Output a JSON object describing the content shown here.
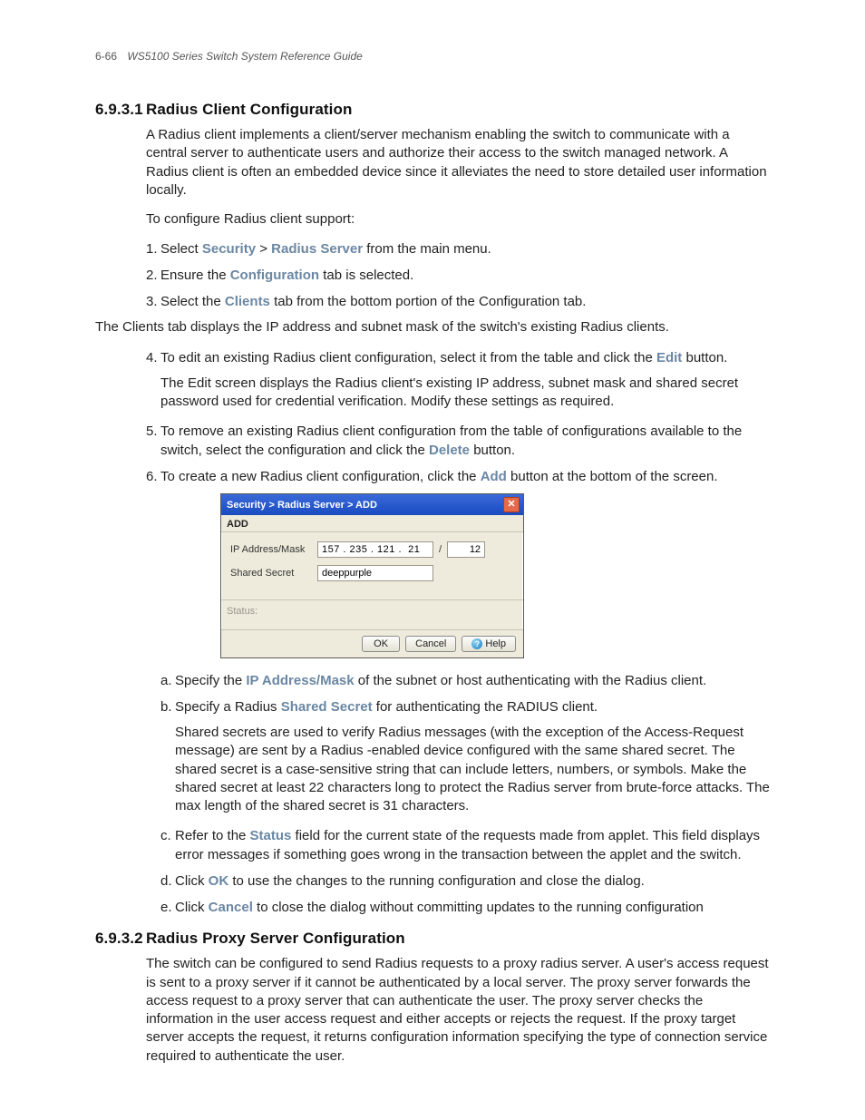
{
  "header": {
    "page_number": "6-66",
    "doc_title": "WS5100 Series Switch System Reference Guide"
  },
  "section1": {
    "number": "6.9.3.1",
    "title": "Radius Client Configuration",
    "intro": "A Radius client implements a client/server mechanism enabling the switch to communicate with a central server to authenticate users and authorize their access to the switch managed network. A Radius client is often an embedded device since it alleviates the need to store detailed user information locally.",
    "lead": "To configure Radius client support:",
    "step1_pre": "Select ",
    "step1_b1": "Security",
    "step1_gt": " > ",
    "step1_b2": "Radius Server",
    "step1_post": " from the main menu.",
    "step2_pre": "Ensure the ",
    "step2_b": "Configuration",
    "step2_post": " tab is selected.",
    "step3_pre": "Select the ",
    "step3_b": "Clients",
    "step3_post": " tab from the bottom portion of the Configuration tab.",
    "clients_tab_desc": "The Clients tab displays the IP address and subnet mask of the switch's existing Radius clients.",
    "step4_pre": "To edit an existing Radius client configuration, select it from the table and click the ",
    "step4_b": "Edit",
    "step4_post": " button.",
    "step4_sub": "The Edit screen displays the Radius client's existing IP address, subnet mask and shared secret password used for credential verification. Modify these settings as required.",
    "step5_pre": "To remove an existing Radius client configuration from the table of configurations available to the switch, select the configuration and click the ",
    "step5_b": "Delete",
    "step5_post": " button.",
    "step6_pre": "To create a new Radius client configuration, click the ",
    "step6_b": "Add",
    "step6_post": " button at the bottom of the screen.",
    "a_pre": "Specify the ",
    "a_b": "IP Address/Mask",
    "a_post": " of the subnet or host authenticating with the Radius client.",
    "b_pre": "Specify a Radius ",
    "b_b": "Shared Secret",
    "b_post": " for authenticating the RADIUS client.",
    "b_sub": "Shared secrets are used to verify Radius messages (with the exception of the Access-Request message) are sent by a Radius -enabled device configured with the same shared secret. The shared secret is a case-sensitive string that can include letters, numbers, or symbols. Make the shared secret at least 22 characters long to protect the Radius server from brute-force attacks. The max length of the shared secret is 31 characters.",
    "c_pre": "Refer to the ",
    "c_b": "Status",
    "c_post": " field for the current state of the requests made from applet. This field displays error messages if something goes wrong in the transaction between the applet and the switch.",
    "d_pre": "Click ",
    "d_b": "OK",
    "d_post": " to use the changes to the running configuration and close the dialog.",
    "e_pre": "Click ",
    "e_b": "Cancel",
    "e_post": " to close the dialog without committing updates to the running configuration"
  },
  "dialog": {
    "titlebar": "Security > Radius Server > ADD",
    "section_title": "ADD",
    "label_ip": "IP Address/Mask",
    "ip_value": "157 . 235 . 121 .  21",
    "slash": "/",
    "mask_value": "12",
    "label_secret": "Shared Secret",
    "secret_value": "deeppurple",
    "status_label": "Status:",
    "btn_ok": "OK",
    "btn_cancel": "Cancel",
    "btn_help": "Help",
    "help_q": "?"
  },
  "section2": {
    "number": "6.9.3.2",
    "title": "Radius Proxy Server Configuration",
    "body": "The switch can be configured to send Radius requests to a proxy radius server. A user's access request is sent to a proxy server if it cannot be authenticated by a local server. The proxy server forwards the access request to a proxy server that can authenticate the user. The proxy server checks the information in the user access request and either accepts or rejects the request. If the proxy target server accepts the request, it returns configuration information specifying the type of connection service required to authenticate the user."
  }
}
